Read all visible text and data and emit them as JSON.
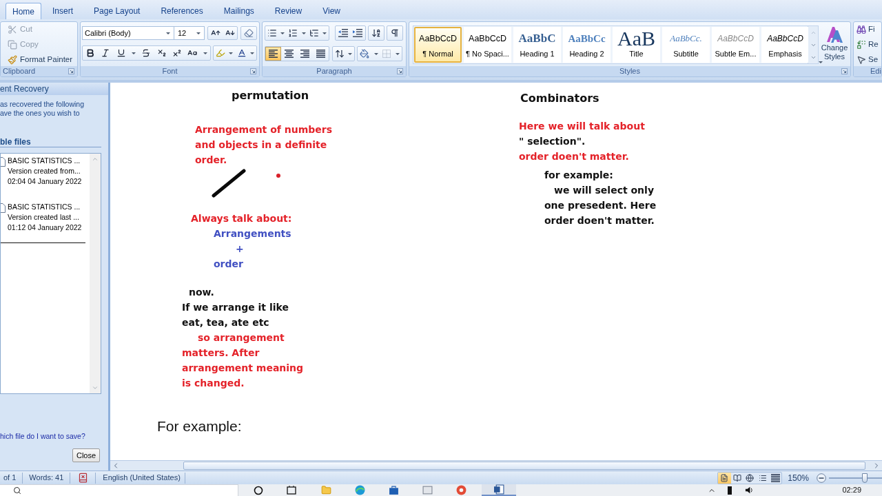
{
  "tabs": [
    {
      "label": "Home",
      "selected": true
    },
    {
      "label": "Insert",
      "selected": false
    },
    {
      "label": "Page Layout",
      "selected": false
    },
    {
      "label": "References",
      "selected": false
    },
    {
      "label": "Mailings",
      "selected": false
    },
    {
      "label": "Review",
      "selected": false
    },
    {
      "label": "View",
      "selected": false
    }
  ],
  "clipboard": {
    "title": "Clipboard",
    "buttons": [
      {
        "kind": "cut",
        "label": "Cut",
        "disabled": true
      },
      {
        "kind": "copy",
        "label": "Copy",
        "disabled": true
      },
      {
        "kind": "format_painter",
        "label": "Format Painter",
        "disabled": false
      }
    ]
  },
  "font": {
    "title": "Font",
    "font_name": "Calibri (Body)",
    "font_size": "12"
  },
  "paragraph": {
    "title": "Paragraph",
    "alignments": [
      {
        "kind": "left",
        "selected": true
      },
      {
        "kind": "center",
        "selected": false
      },
      {
        "kind": "right",
        "selected": false
      },
      {
        "kind": "justify",
        "selected": false
      }
    ]
  },
  "styles": {
    "title": "Styles",
    "items": [
      {
        "kind": "normal",
        "sample": "AaBbCcD",
        "label": "¶ Normal",
        "selected": true
      },
      {
        "kind": "no_spacing",
        "sample": "AaBbCcD",
        "label": "¶ No Spaci...",
        "selected": false
      },
      {
        "kind": "heading1",
        "sample": "AaBbC",
        "label": "Heading 1",
        "selected": false
      },
      {
        "kind": "heading2",
        "sample": "AaBbCc",
        "label": "Heading 2",
        "selected": false
      },
      {
        "kind": "title",
        "sample": "AaB",
        "label": "Title",
        "selected": false
      },
      {
        "kind": "subtitle",
        "sample": "AaBbCc.",
        "label": "Subtitle",
        "selected": false
      },
      {
        "kind": "subtle_emphasis",
        "sample": "AaBbCcD",
        "label": "Subtle Em...",
        "selected": false
      },
      {
        "kind": "emphasis",
        "sample": "AaBbCcD",
        "label": "Emphasis",
        "selected": false
      }
    ],
    "change_styles": "Change Styles"
  },
  "editing": {
    "title": "Edi",
    "buttons": [
      {
        "kind": "find",
        "label": "Fi"
      },
      {
        "kind": "replace",
        "label": "Re"
      },
      {
        "kind": "select",
        "label": "Se"
      }
    ]
  },
  "recovery_pane": {
    "title": "ent Recovery",
    "message_lines": [
      "as recovered the following",
      "ave the ones you wish to"
    ],
    "section_title": "ble files",
    "files": [
      {
        "name": "BASIC STATISTICS ...",
        "detail": "Version created from...",
        "time": "02:04 04 January 2022"
      },
      {
        "name": "BASIC STATISTICS ...",
        "detail": "Version created last ...",
        "time": "01:12 04 January 2022"
      }
    ],
    "help_link": "hich file do I want to save?",
    "close_button": "Close"
  },
  "document": {
    "left_column": [
      {
        "kind": "heading",
        "lines": [
          "permutation"
        ],
        "color": "#111111"
      },
      {
        "kind": "body",
        "lines": [
          "Arrangement of numbers",
          "and objects in a definite",
          "order."
        ],
        "color": "#e42229"
      },
      {
        "kind": "ink"
      },
      {
        "kind": "body",
        "lines": [
          "Always talk about:"
        ],
        "color": "#e42229"
      },
      {
        "kind": "body",
        "lines": [
          "Arrangements",
          "+",
          "order"
        ],
        "color": "#4150c2"
      },
      {
        "kind": "body",
        "lines": [
          "now.",
          "If we arrange it like",
          "eat, tea, ate etc"
        ],
        "color": "#111111"
      },
      {
        "kind": "body",
        "lines": [
          "so arrangement",
          "matters. After",
          "arrangement meaning",
          "is changed."
        ],
        "color": "#e42229"
      },
      {
        "kind": "plain",
        "lines": [
          "For example:"
        ],
        "color": "#111111"
      }
    ],
    "right_column": [
      {
        "kind": "heading",
        "lines": [
          "Combinators"
        ],
        "color": "#111111"
      },
      {
        "kind": "body",
        "lines": [
          "Here we will talk about"
        ],
        "color": "#e42229"
      },
      {
        "kind": "body",
        "lines": [
          "\" selection\"."
        ],
        "color": "#111111"
      },
      {
        "kind": "body",
        "lines": [
          "order doen't matter."
        ],
        "color": "#e42229"
      },
      {
        "kind": "body",
        "lines": [
          "for example:",
          "we will select only",
          "one presedent. Here",
          "order doen't matter."
        ],
        "color": "#111111"
      }
    ]
  },
  "status_bar": {
    "page": "of 1",
    "words": "Words: 41",
    "language": "English (United States)",
    "views": [
      {
        "kind": "print_layout",
        "selected": true
      },
      {
        "kind": "full_screen_reading",
        "selected": false
      },
      {
        "kind": "web_layout",
        "selected": false
      },
      {
        "kind": "outline",
        "selected": false
      },
      {
        "kind": "draft",
        "selected": false
      }
    ],
    "zoom": "150%",
    "zoom_slider": {
      "level": 0.68
    }
  },
  "taskbar": {
    "clock": "02:29"
  }
}
